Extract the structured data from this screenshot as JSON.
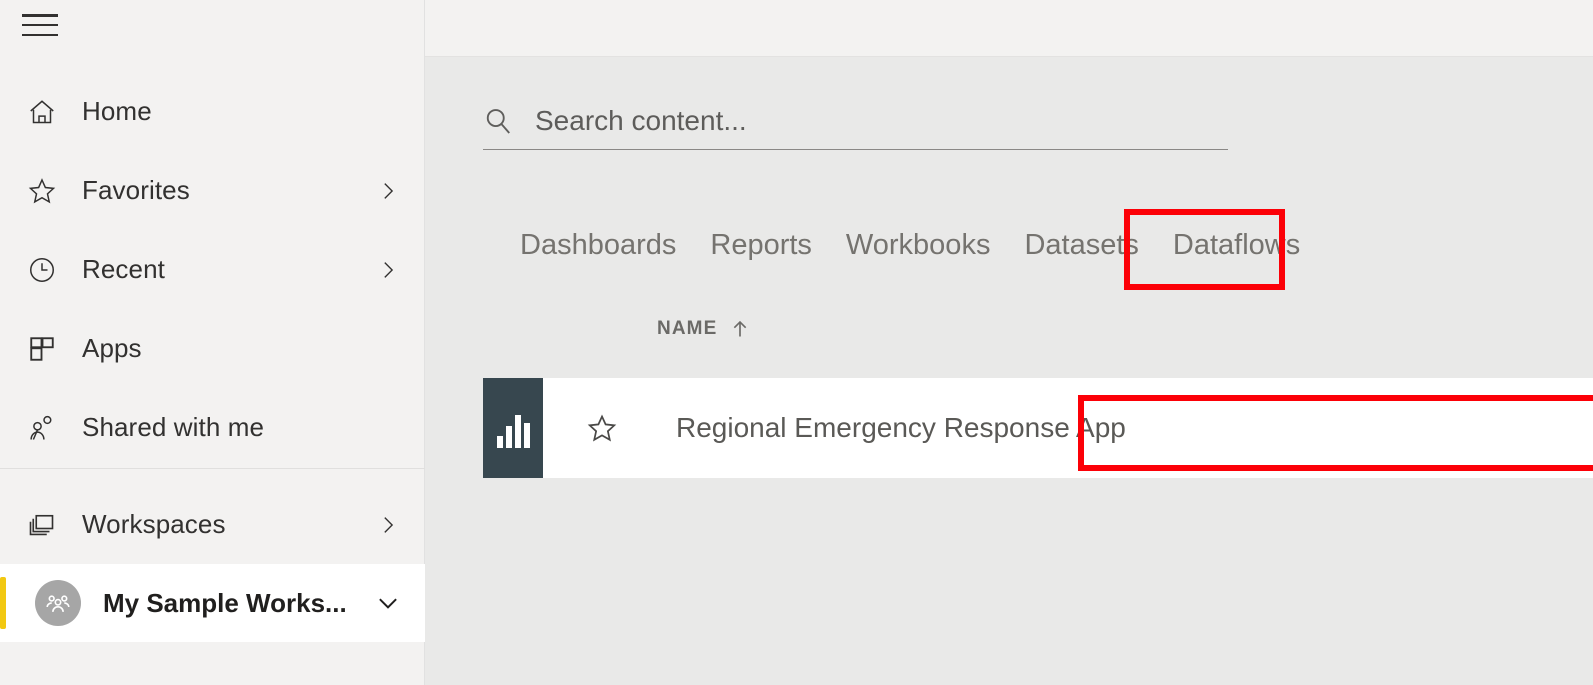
{
  "sidebar": {
    "menu_toggle": "hamburger-menu",
    "nav_items": [
      {
        "label": "Home",
        "icon": "home-icon",
        "has_chevron": false
      },
      {
        "label": "Favorites",
        "icon": "star-icon",
        "has_chevron": true
      },
      {
        "label": "Recent",
        "icon": "clock-icon",
        "has_chevron": true
      },
      {
        "label": "Apps",
        "icon": "apps-grid-icon",
        "has_chevron": false
      },
      {
        "label": "Shared with me",
        "icon": "people-share-icon",
        "has_chevron": false
      }
    ],
    "workspace_items": [
      {
        "label": "Workspaces",
        "icon": "workspaces-stack-icon",
        "chevron": "chevron-right-icon",
        "active": false
      },
      {
        "label": "My Sample Works...",
        "icon": "workspace-avatar-icon",
        "chevron": "chevron-down-icon",
        "active": true
      }
    ],
    "accent_color": "#f2c811"
  },
  "search": {
    "placeholder": "Search content...",
    "value": "",
    "icon": "search-icon"
  },
  "tabs": {
    "items": [
      {
        "label": "Dashboards",
        "selected": false
      },
      {
        "label": "Reports",
        "selected": true
      },
      {
        "label": "Workbooks",
        "selected": false
      },
      {
        "label": "Datasets",
        "selected": false
      },
      {
        "label": "Dataflows",
        "selected": false
      }
    ]
  },
  "table": {
    "columns": [
      {
        "label": "NAME",
        "sort": "ascending",
        "sort_icon": "arrow-up-icon"
      }
    ],
    "rows": [
      {
        "name": "Regional Emergency Response App",
        "type_icon": "report-bar-chart-icon",
        "favorite_icon": "star-outline-icon",
        "favorited": false
      }
    ]
  },
  "annotations": {
    "color": "#fc0007",
    "boxes": [
      {
        "target": "Reports",
        "label": "reports-tab-highlight"
      },
      {
        "target": "Regional Emergency Response App",
        "label": "report-name-highlight"
      }
    ]
  }
}
